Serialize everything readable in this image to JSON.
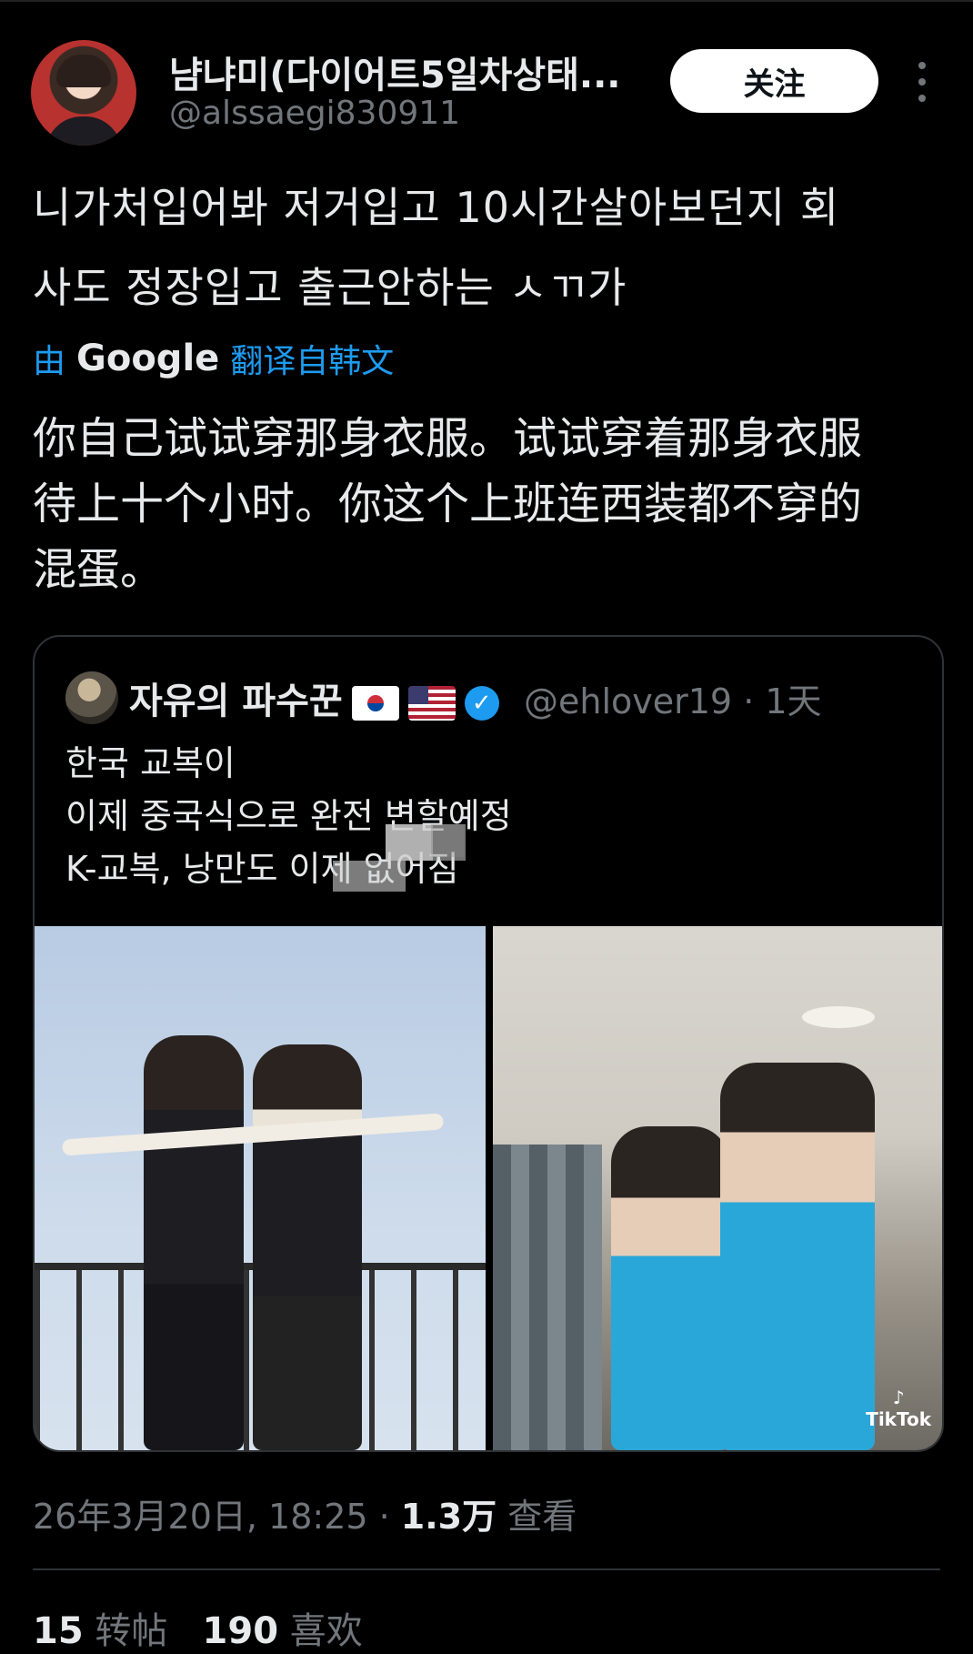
{
  "author": {
    "display_name": "냠냐미(다이어트5일차상태...",
    "handle": "@alssaegi830911"
  },
  "follow_label": "关注",
  "tweet": {
    "text_line1": "니가처입어봐 저거입고 10시간살아보던지 회",
    "text_line2": "사도 정장입고 출근안하는 ㅅㄲ가",
    "translate_prefix": "由",
    "translate_brand": "Google",
    "translate_suffix": "翻译自韩文",
    "translated_line1": "你自己试试穿那身衣服。试试穿着那身衣服",
    "translated_line2": "待上十个小时。你这个上班连西装都不穿的",
    "translated_line3": "混蛋。"
  },
  "quote": {
    "name": "자유의 파수꾼",
    "handle_time": "@ehlover19 · 1天",
    "line1": "한국 교복이",
    "line2": "이제 중국식으로 완전 변할예정",
    "line3": "K-교복, 낭만도 이제 없어짐",
    "tiktok_label": "TikTok"
  },
  "meta": {
    "datetime": "26年3月20日, 18:25 · ",
    "views_count": "1.3万",
    "views_label": " 查看"
  },
  "stats": {
    "reposts_count": "15",
    "reposts_label": "转帖",
    "likes_count": "190",
    "likes_label": "喜欢"
  }
}
